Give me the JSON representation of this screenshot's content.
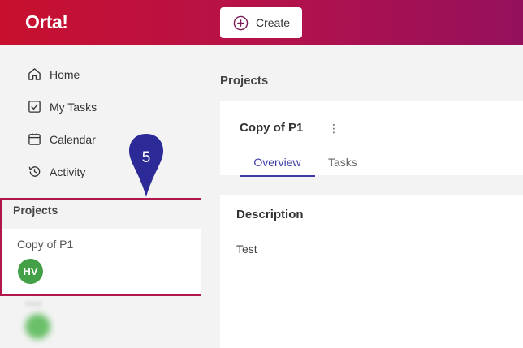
{
  "header": {
    "logo": "Orta!",
    "create_label": "Create"
  },
  "sidebar": {
    "nav": [
      {
        "label": "Home",
        "icon": "home-icon"
      },
      {
        "label": "My Tasks",
        "icon": "checkbox-icon"
      },
      {
        "label": "Calendar",
        "icon": "calendar-icon"
      },
      {
        "label": "Activity",
        "icon": "history-icon"
      }
    ],
    "projects_header": "Projects",
    "projects": [
      {
        "name": "Copy of P1",
        "avatar": "HV"
      }
    ]
  },
  "callout": {
    "number": "5",
    "color": "#2b2a96"
  },
  "main": {
    "breadcrumb": "Projects",
    "project_title": "Copy of P1",
    "menu_icon": "⋮",
    "tabs": [
      {
        "label": "Overview",
        "active": true
      },
      {
        "label": "Tasks",
        "active": false
      }
    ],
    "description_title": "Description",
    "description_text": "Test"
  },
  "colors": {
    "brand_start": "#c8102e",
    "brand_end": "#94105c",
    "tab_active": "#3b3ba8",
    "highlight": "#b0174c",
    "avatar": "#43a047"
  }
}
